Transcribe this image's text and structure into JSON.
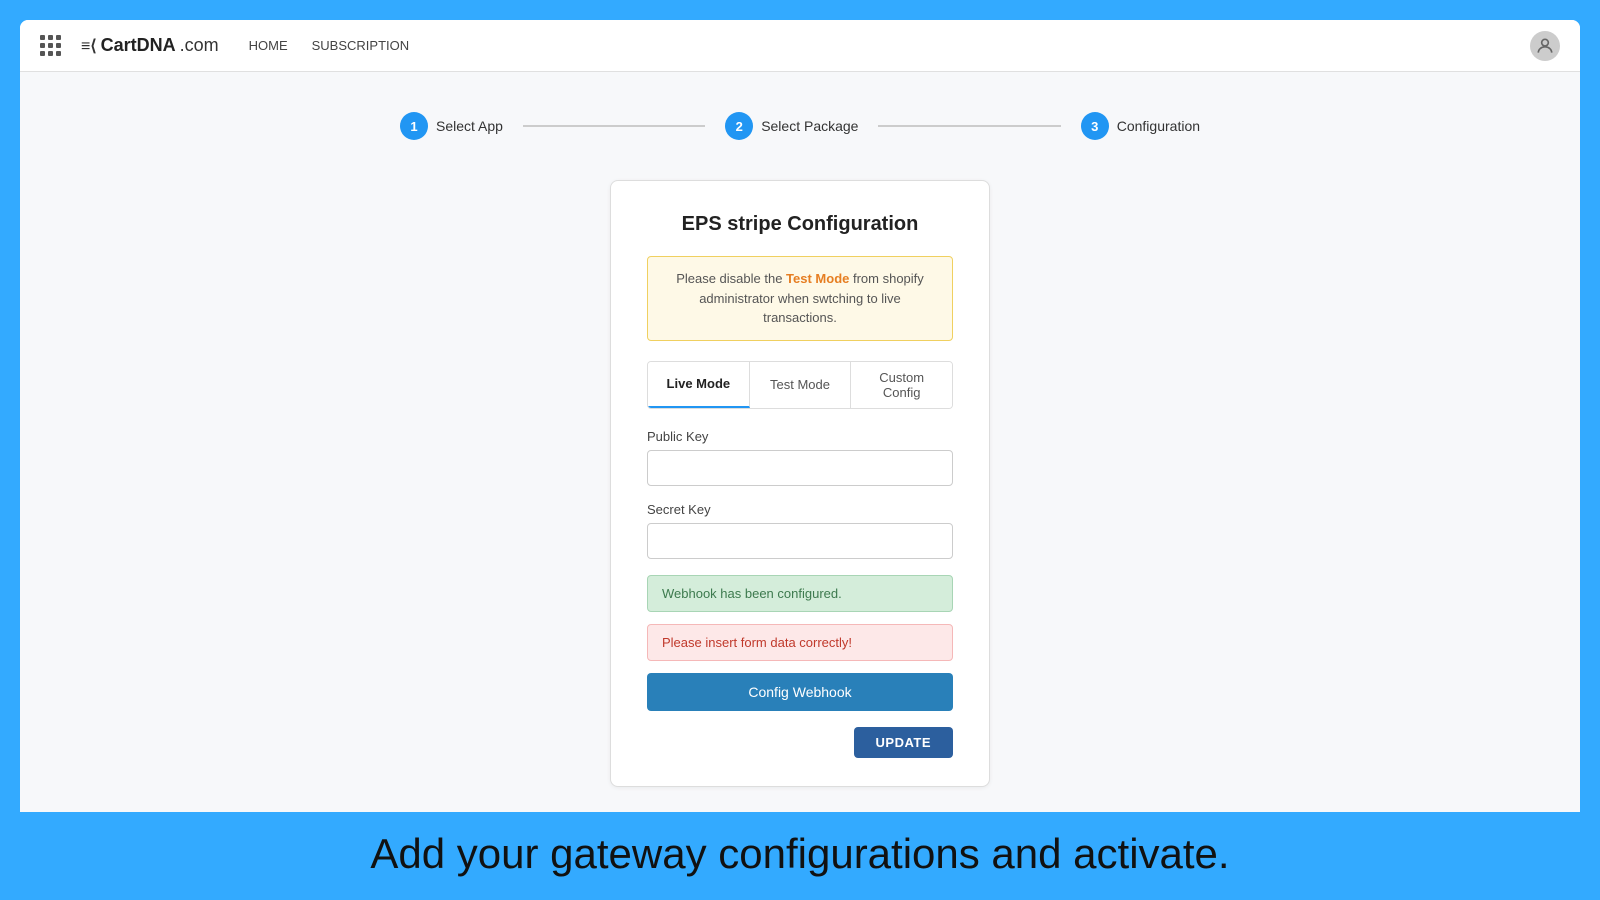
{
  "navbar": {
    "brand_text": "CartDNA",
    "brand_suffix": ".com",
    "nav_links": [
      {
        "label": "HOME",
        "id": "home"
      },
      {
        "label": "SUBSCRIPTION",
        "id": "subscription"
      }
    ]
  },
  "stepper": {
    "steps": [
      {
        "number": "1",
        "label": "Select App"
      },
      {
        "number": "2",
        "label": "Select Package"
      },
      {
        "number": "3",
        "label": "Configuration"
      }
    ]
  },
  "form": {
    "title": "EPS stripe Configuration",
    "warning_text_1": "Please disable the ",
    "warning_highlight": "Test Mode",
    "warning_text_2": " from shopify",
    "warning_text_3": "administrator when swtching to live transactions.",
    "tabs": [
      {
        "label": "Live Mode",
        "active": true
      },
      {
        "label": "Test Mode",
        "active": false
      },
      {
        "label": "Custom Config",
        "active": false
      }
    ],
    "public_key_label": "Public Key",
    "public_key_placeholder": "",
    "secret_key_label": "Secret Key",
    "secret_key_placeholder": "",
    "success_message": "Webhook has been configured.",
    "error_message": "Please insert form data correctly!",
    "webhook_button_label": "Config Webhook",
    "update_button_label": "UPDATE"
  },
  "caption": {
    "text": "Add your gateway configurations and activate."
  }
}
